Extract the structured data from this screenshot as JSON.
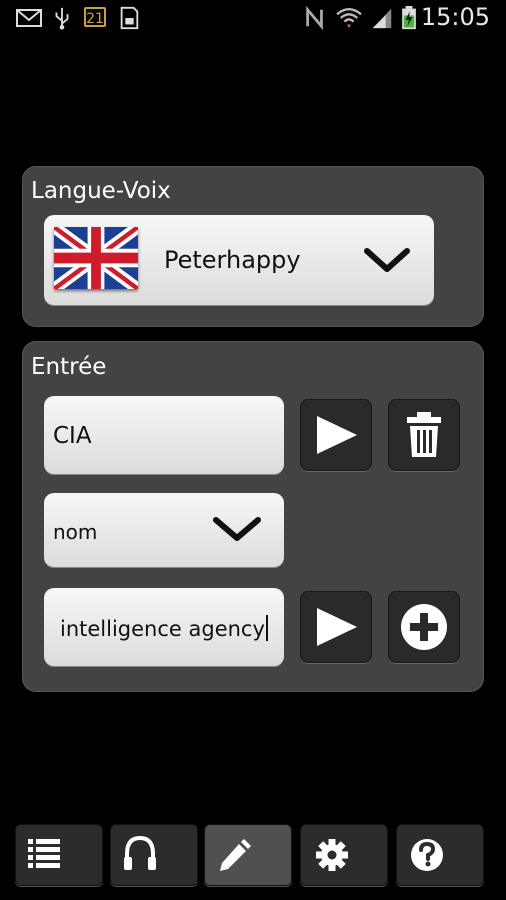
{
  "status_bar": {
    "time": "15:05",
    "badge": "21",
    "icons": [
      "mail-icon",
      "usb-icon",
      "calendar-badge-icon",
      "sd-card-icon",
      "nfc-icon",
      "wifi-icon",
      "signal-icon",
      "battery-charging-icon"
    ]
  },
  "language_panel": {
    "title": "Langue-Voix",
    "voice": "Peterhappy",
    "flag_icon": "uk-flag-icon"
  },
  "entry_panel": {
    "title": "Entrée",
    "word_value": "CIA",
    "part_of_speech": "nom",
    "definition_value": "intelligence agency"
  },
  "toolbar": {
    "items": [
      "list-icon",
      "headphones-icon",
      "pencil-icon",
      "gear-icon",
      "help-icon"
    ],
    "active_index": 2
  },
  "colors": {
    "background": "#000000",
    "panel": "#434343",
    "dark_button": "#2a2a2a",
    "active_tab": "#505050"
  }
}
